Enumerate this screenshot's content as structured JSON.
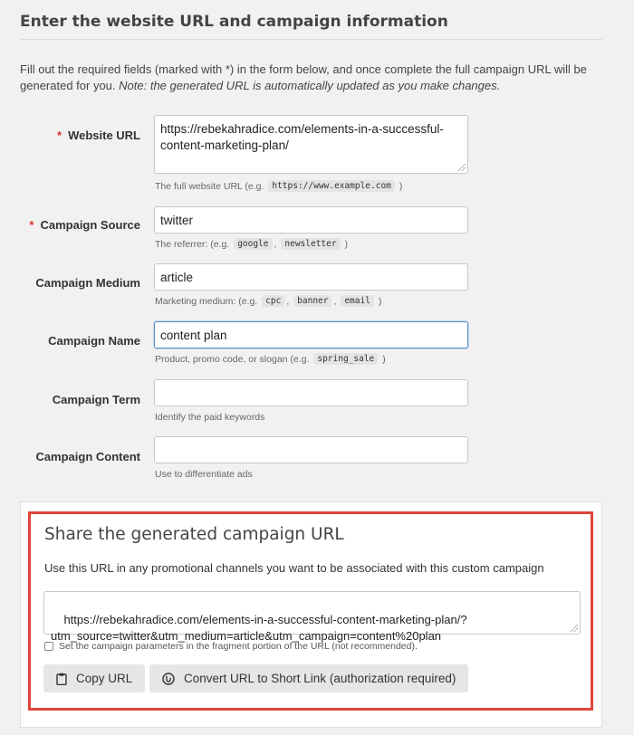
{
  "header": {
    "title": "Enter the website URL and campaign information"
  },
  "intro": {
    "text": "Fill out the required fields (marked with *) in the form below, and once complete the full campaign URL will be generated for you.",
    "note": "Note: the generated URL is automatically updated as you make changes."
  },
  "fields": {
    "website_url": {
      "label": "Website URL",
      "required": "*",
      "value": "https://rebekahradice.com/elements-in-a-successful-\ncontent-marketing-plan/",
      "help_prefix": "The full website URL (e.g.",
      "help_code": "https://www.example.com",
      "help_suffix": ")"
    },
    "campaign_source": {
      "label": "Campaign Source",
      "required": "*",
      "value": "twitter",
      "help_prefix": "The referrer: (e.g.",
      "help_code1": "google",
      "help_sep": ",",
      "help_code2": "newsletter",
      "help_suffix": ")"
    },
    "campaign_medium": {
      "label": "Campaign Medium",
      "value": "article",
      "help_prefix": "Marketing medium: (e.g.",
      "help_code1": "cpc",
      "help_sep1": ",",
      "help_code2": "banner",
      "help_sep2": ",",
      "help_code3": "email",
      "help_suffix": ")"
    },
    "campaign_name": {
      "label": "Campaign Name",
      "value": "content plan",
      "help_prefix": "Product, promo code, or slogan (e.g.",
      "help_code": "spring_sale",
      "help_suffix": ")"
    },
    "campaign_term": {
      "label": "Campaign Term",
      "value": "",
      "help": "Identify the paid keywords"
    },
    "campaign_content": {
      "label": "Campaign Content",
      "value": "",
      "help": "Use to differentiate ads"
    }
  },
  "share": {
    "title": "Share the generated campaign URL",
    "description": "Use this URL in any promotional channels you want to be associated with this custom campaign",
    "generated_url": "https://rebekahradice.com/elements-in-a-successful-content-marketing-plan/?\nutm_source=twitter&utm_medium=article&utm_campaign=content%20plan",
    "fragment_checkbox_label": "Set the campaign parameters in the fragment portion of the URL (not recommended).",
    "copy_button": "Copy URL",
    "shorten_button": "Convert URL to Short Link (authorization required)",
    "copy_icon": "clipboard-icon",
    "shorten_icon": "link-icon"
  },
  "colors": {
    "required": "#d9342b",
    "highlight_border": "#e0463a",
    "focus_border": "#5b8ccd",
    "page_background": "#f1f1f1"
  }
}
